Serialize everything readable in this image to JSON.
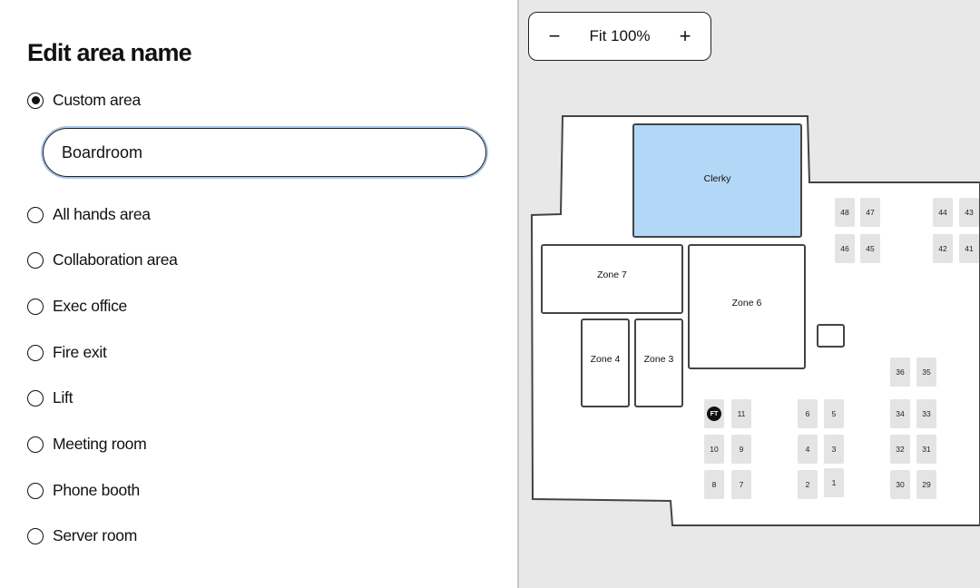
{
  "panel": {
    "title": "Edit area name",
    "selected": "Custom area",
    "custom_input_value": "Boardroom",
    "options": [
      "Custom area",
      "All hands area",
      "Collaboration area",
      "Exec office",
      "Fire exit",
      "Lift",
      "Meeting room",
      "Phone booth",
      "Server room"
    ]
  },
  "map": {
    "zoom_label": "Fit 100%",
    "zoom_out_icon": "minus-icon",
    "zoom_in_icon": "plus-icon",
    "highlight_color": "#b3d7f6",
    "rooms": [
      "Clerky",
      "Zone 7",
      "Zone 6",
      "Zone 4",
      "Zone 3",
      ""
    ],
    "seats": [
      "48",
      "47",
      "44",
      "43",
      "46",
      "45",
      "42",
      "41",
      "36",
      "35",
      "FT",
      "11",
      "6",
      "5",
      "34",
      "33",
      "10",
      "9",
      "4",
      "3",
      "32",
      "31",
      "8",
      "7",
      "2",
      "1",
      "30",
      "29"
    ]
  }
}
